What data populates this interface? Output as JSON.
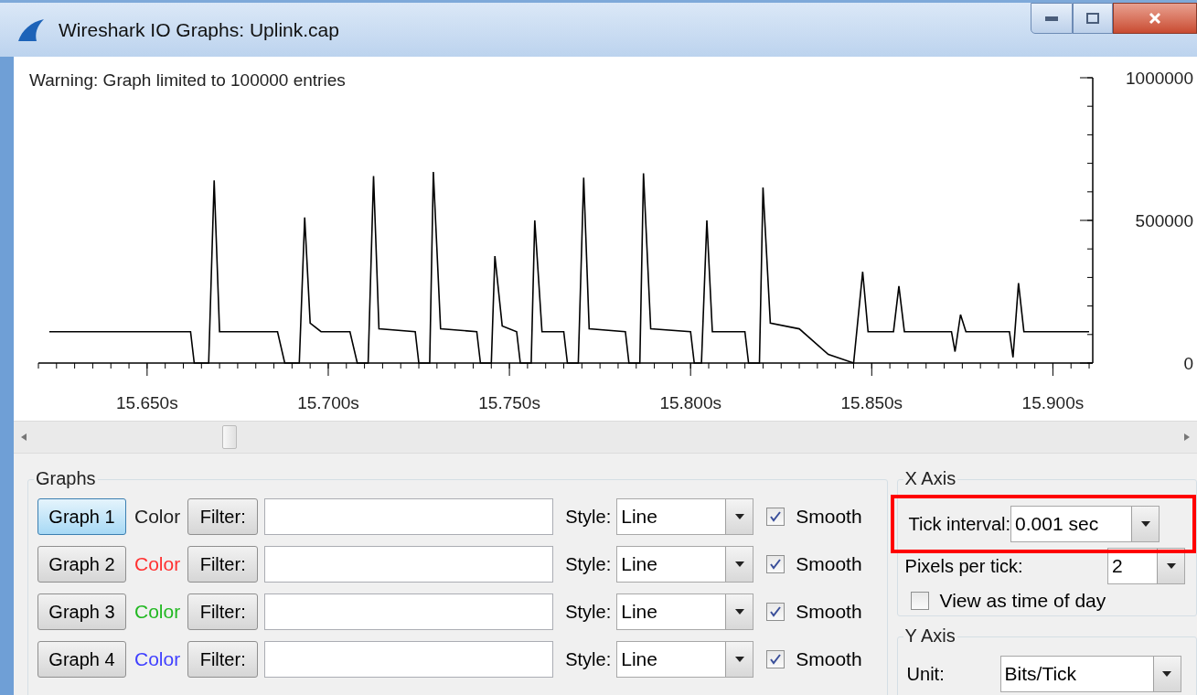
{
  "window": {
    "title": "Wireshark IO Graphs: Uplink.cap"
  },
  "graph_area": {
    "warning": "Warning: Graph limited to 100000 entries",
    "chart_data": {
      "type": "line",
      "xlim": [
        15.62,
        15.911
      ],
      "ylim": [
        0,
        1000000
      ],
      "xticks": [
        {
          "value": 15.65,
          "label": "15.650s"
        },
        {
          "value": 15.7,
          "label": "15.700s"
        },
        {
          "value": 15.75,
          "label": "15.750s"
        },
        {
          "value": 15.8,
          "label": "15.800s"
        },
        {
          "value": 15.85,
          "label": "15.850s"
        },
        {
          "value": 15.9,
          "label": "15.900s"
        }
      ],
      "yticks": [
        {
          "value": 0,
          "label": "0"
        },
        {
          "value": 500000,
          "label": "500000"
        },
        {
          "value": 1000000,
          "label": "1000000"
        }
      ],
      "x": [
        15.623,
        15.662,
        15.663,
        15.667,
        15.6685,
        15.67,
        15.686,
        15.688,
        15.692,
        15.6935,
        15.695,
        15.698,
        15.706,
        15.708,
        15.711,
        15.7125,
        15.714,
        15.724,
        15.725,
        15.728,
        15.729,
        15.731,
        15.741,
        15.742,
        15.745,
        15.746,
        15.748,
        15.752,
        15.753,
        15.756,
        15.757,
        15.759,
        15.765,
        15.766,
        15.769,
        15.7705,
        15.772,
        15.782,
        15.783,
        15.786,
        15.787,
        15.789,
        15.8,
        15.801,
        15.803,
        15.8045,
        15.806,
        15.815,
        15.816,
        15.819,
        15.82,
        15.822,
        15.83,
        15.838,
        15.845,
        15.8475,
        15.849,
        15.856,
        15.8575,
        15.859,
        15.872,
        15.873,
        15.8745,
        15.876,
        15.888,
        15.889,
        15.8905,
        15.892,
        15.91
      ],
      "series": [
        {
          "color": "#000000",
          "values": [
            110000,
            110000,
            0,
            0,
            640000,
            110000,
            110000,
            0,
            0,
            510000,
            140000,
            110000,
            110000,
            0,
            0,
            655000,
            120000,
            110000,
            0,
            0,
            670000,
            120000,
            110000,
            0,
            0,
            375000,
            130000,
            110000,
            0,
            0,
            500000,
            110000,
            110000,
            0,
            0,
            650000,
            120000,
            110000,
            0,
            0,
            665000,
            120000,
            110000,
            0,
            0,
            500000,
            110000,
            110000,
            0,
            0,
            615000,
            140000,
            120000,
            30000,
            0,
            320000,
            110000,
            110000,
            270000,
            110000,
            110000,
            40000,
            170000,
            110000,
            110000,
            20000,
            280000,
            110000,
            110000
          ]
        }
      ]
    }
  },
  "graphs": {
    "title": "Graphs",
    "rows": [
      {
        "label": "Graph 1",
        "selected": true,
        "color_label": "Color",
        "color": "#202020",
        "filter_button": "Filter:",
        "style_label": "Style:",
        "style": "Line",
        "smooth": true,
        "smooth_label": "Smooth"
      },
      {
        "label": "Graph 2",
        "selected": false,
        "color_label": "Color",
        "color": "#ff3030",
        "filter_button": "Filter:",
        "style_label": "Style:",
        "style": "Line",
        "smooth": true,
        "smooth_label": "Smooth"
      },
      {
        "label": "Graph 3",
        "selected": false,
        "color_label": "Color",
        "color": "#22b822",
        "filter_button": "Filter:",
        "style_label": "Style:",
        "style": "Line",
        "smooth": true,
        "smooth_label": "Smooth"
      },
      {
        "label": "Graph 4",
        "selected": false,
        "color_label": "Color",
        "color": "#4040ff",
        "filter_button": "Filter:",
        "style_label": "Style:",
        "style": "Line",
        "smooth": true,
        "smooth_label": "Smooth"
      }
    ]
  },
  "x_axis": {
    "title": "X Axis",
    "tick_interval_label": "Tick interval:",
    "tick_interval": "0.001 sec",
    "tick_interval_highlighted": true,
    "pixels_label": "Pixels per tick:",
    "pixels": "2",
    "time_of_day_label": "View as time of day",
    "time_of_day": false
  },
  "y_axis": {
    "title": "Y Axis",
    "unit_label": "Unit:",
    "unit": "Bits/Tick"
  }
}
